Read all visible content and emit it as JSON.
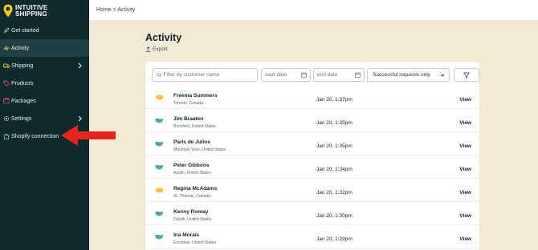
{
  "brand": {
    "line1": "INTUITIVE",
    "line2": "SHIPPING",
    "pin_color": "#f5c518"
  },
  "sidebar": {
    "items": [
      {
        "label": "Get started",
        "icon": "rocket-icon",
        "active": false,
        "chevron": false
      },
      {
        "label": "Activity",
        "icon": "activity-icon",
        "active": true,
        "chevron": false
      },
      {
        "label": "Shipping",
        "icon": "truck-icon",
        "active": false,
        "chevron": true
      },
      {
        "label": "Products",
        "icon": "tag-icon",
        "active": false,
        "chevron": false
      },
      {
        "label": "Packages",
        "icon": "box-icon",
        "active": false,
        "chevron": false
      },
      {
        "label": "Settings",
        "icon": "gear-icon",
        "active": false,
        "chevron": true
      },
      {
        "label": "Shopify connection",
        "icon": "bag-icon",
        "active": false,
        "chevron": false
      }
    ]
  },
  "breadcrumb": "Home > Activity",
  "page": {
    "title": "Activity",
    "export_label": "Export"
  },
  "filters": {
    "search_placeholder": "Filter by customer name",
    "start_placeholder": "start date",
    "end_placeholder": "end date",
    "status_value": "Successful requests only"
  },
  "rows": [
    {
      "name": "Freema Summers",
      "location": "Toronto, Canada",
      "time": "Jan 20, 1:37pm",
      "action": "View",
      "country": "canada"
    },
    {
      "name": "Jim Braaten",
      "location": "Rockford, United States",
      "time": "Jan 20, 1:35pm",
      "action": "View",
      "country": "usa"
    },
    {
      "name": "Paris de Julios",
      "location": "Mountain View, United States",
      "time": "Jan 20, 1:35pm",
      "action": "View",
      "country": "usa"
    },
    {
      "name": "Peter Gibbons",
      "location": "Austin, United States",
      "time": "Jan 20, 1:34pm",
      "action": "View",
      "country": "usa"
    },
    {
      "name": "Regina McAdams",
      "location": "St. Thomas, Canada",
      "time": "Jan 20, 1:32pm",
      "action": "View",
      "country": "canada"
    },
    {
      "name": "Kenny Romay",
      "location": "Duluth, United States",
      "time": "Jan 20, 1:30pm",
      "action": "View",
      "country": "usa"
    },
    {
      "name": "Ina Morais",
      "location": "Encinitas, United States",
      "time": "Jan 20, 1:29pm",
      "action": "View",
      "country": "usa"
    }
  ],
  "colors": {
    "sidebar": "#0e2a2d",
    "canvas": "#f3ead6",
    "usa_map": "#4fa6a0",
    "canada_map": "#f2c53d",
    "arrow": "#e8231e"
  }
}
